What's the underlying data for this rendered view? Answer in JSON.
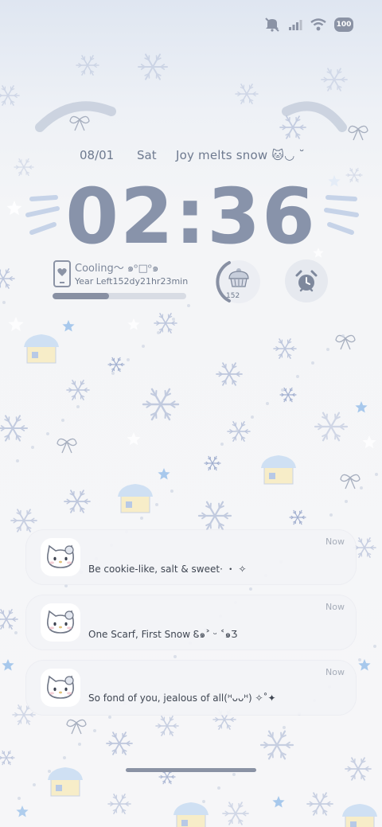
{
  "status_bar": {
    "icons": [
      "mute-icon",
      "signal-icon",
      "wifi-icon",
      "battery-icon"
    ],
    "battery_level": "100"
  },
  "header": {
    "date": "08/01",
    "day": "Sat",
    "message": "Joy melts snow 🐱◡ ˘"
  },
  "clock": {
    "time": "02:36"
  },
  "widget": {
    "cooling_text": "Cooling～ ๑ᵒ□ᵒ๑",
    "year_left": "Year Left152dy21hr23min",
    "year_progress": 0.42,
    "days_count": "152",
    "cake_icon": "cake-icon",
    "alarm_icon": "alarm-clock-icon"
  },
  "notifications": [
    {
      "time": "Now",
      "text": "Be cookie-like, salt & sweet· ・ ✧"
    },
    {
      "time": "Now",
      "text": "One Scarf, First Snow Ꮛ๑˃ ᵕ ˂๑Ʒ"
    },
    {
      "time": "Now",
      "text": "So fond of you, jealous of all(ᴴᴗᴗᴴ) ✧˚✦"
    }
  ],
  "colors": {
    "clock": "#8893aa",
    "accent": "#8890a3",
    "star": "#9ec3ea",
    "snowflake": "#9aa9cc"
  }
}
